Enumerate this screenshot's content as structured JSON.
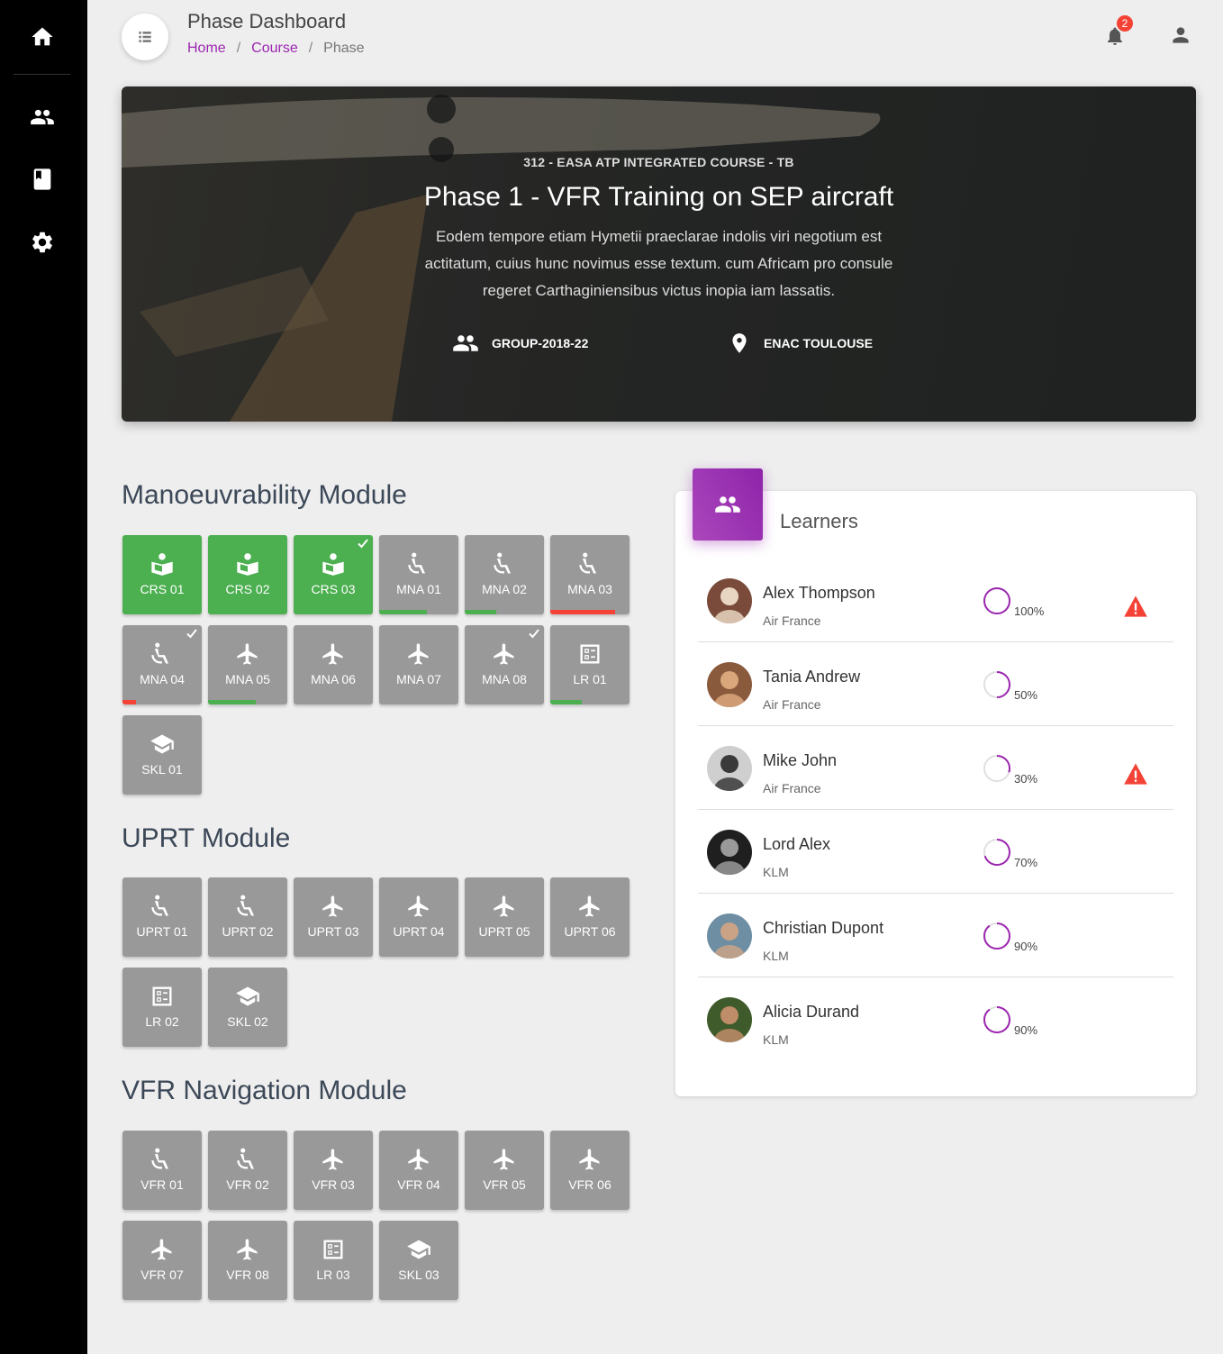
{
  "header": {
    "title": "Phase Dashboard",
    "breadcrumb": [
      "Home",
      "Course",
      "Phase"
    ],
    "notification_count": "2"
  },
  "sidebar": {
    "items": [
      {
        "icon": "home-icon"
      },
      {
        "icon": "people-icon"
      },
      {
        "icon": "book-icon"
      },
      {
        "icon": "gear-icon"
      }
    ]
  },
  "hero": {
    "subtitle": "312 - EASA ATP INTEGRATED COURSE - TB",
    "title": "Phase 1 - VFR Training on SEP aircraft",
    "description": "Eodem tempore etiam Hymetii praeclarae indolis viri negotium est actitatum, cuius hunc novimus esse textum. cum Africam pro consule regeret Carthaginiensibus victus inopia iam lassatis.",
    "group": "GROUP-2018-22",
    "location": "ENAC TOULOUSE"
  },
  "colors": {
    "accent": "#9c27b0",
    "tile_done": "#4caf50",
    "tile_default": "#999999",
    "progress_good": "#4caf50",
    "progress_bad": "#f44336"
  },
  "modules": [
    {
      "title": "Manoeuvrability Module",
      "tiles": [
        {
          "label": "CRS 01",
          "icon": "book-reader-icon",
          "status": "done",
          "checked": false,
          "progress": 0,
          "progress_color": ""
        },
        {
          "label": "CRS 02",
          "icon": "book-reader-icon",
          "status": "done",
          "checked": false,
          "progress": 0,
          "progress_color": ""
        },
        {
          "label": "CRS 03",
          "icon": "book-reader-icon",
          "status": "done",
          "checked": true,
          "progress": 0,
          "progress_color": ""
        },
        {
          "label": "MNA 01",
          "icon": "seat-icon",
          "status": "pending",
          "checked": false,
          "progress": 0.6,
          "progress_color": "#4caf50"
        },
        {
          "label": "MNA 02",
          "icon": "seat-icon",
          "status": "pending",
          "checked": false,
          "progress": 0.4,
          "progress_color": "#4caf50"
        },
        {
          "label": "MNA 03",
          "icon": "seat-icon",
          "status": "pending",
          "checked": false,
          "progress": 0.82,
          "progress_color": "#f44336"
        },
        {
          "label": "MNA 04",
          "icon": "seat-icon",
          "status": "pending",
          "checked": true,
          "progress": 0.17,
          "progress_color": "#f44336"
        },
        {
          "label": "MNA 05",
          "icon": "plane-icon",
          "status": "pending",
          "checked": false,
          "progress": 0.6,
          "progress_color": "#4caf50"
        },
        {
          "label": "MNA 06",
          "icon": "plane-icon",
          "status": "pending",
          "checked": false,
          "progress": 0,
          "progress_color": ""
        },
        {
          "label": "MNA 07",
          "icon": "plane-icon",
          "status": "pending",
          "checked": false,
          "progress": 0,
          "progress_color": ""
        },
        {
          "label": "MNA 08",
          "icon": "plane-icon",
          "status": "pending",
          "checked": true,
          "progress": 0,
          "progress_color": ""
        },
        {
          "label": "LR 01",
          "icon": "checklist-icon",
          "status": "pending",
          "checked": false,
          "progress": 0.4,
          "progress_color": "#4caf50"
        },
        {
          "label": "SKL 01",
          "icon": "graduation-cap-icon",
          "status": "pending",
          "checked": false,
          "progress": 0,
          "progress_color": ""
        }
      ]
    },
    {
      "title": "UPRT Module",
      "tiles": [
        {
          "label": "UPRT 01",
          "icon": "seat-icon",
          "status": "pending",
          "checked": false,
          "progress": 0,
          "progress_color": ""
        },
        {
          "label": "UPRT 02",
          "icon": "seat-icon",
          "status": "pending",
          "checked": false,
          "progress": 0,
          "progress_color": ""
        },
        {
          "label": "UPRT 03",
          "icon": "plane-icon",
          "status": "pending",
          "checked": false,
          "progress": 0,
          "progress_color": ""
        },
        {
          "label": "UPRT 04",
          "icon": "plane-icon",
          "status": "pending",
          "checked": false,
          "progress": 0,
          "progress_color": ""
        },
        {
          "label": "UPRT 05",
          "icon": "plane-icon",
          "status": "pending",
          "checked": false,
          "progress": 0,
          "progress_color": ""
        },
        {
          "label": "UPRT 06",
          "icon": "plane-icon",
          "status": "pending",
          "checked": false,
          "progress": 0,
          "progress_color": ""
        },
        {
          "label": "LR 02",
          "icon": "checklist-icon",
          "status": "pending",
          "checked": false,
          "progress": 0,
          "progress_color": ""
        },
        {
          "label": "SKL 02",
          "icon": "graduation-cap-icon",
          "status": "pending",
          "checked": false,
          "progress": 0,
          "progress_color": ""
        }
      ]
    },
    {
      "title": "VFR Navigation Module",
      "tiles": [
        {
          "label": "VFR 01",
          "icon": "seat-icon",
          "status": "pending",
          "checked": false,
          "progress": 0,
          "progress_color": ""
        },
        {
          "label": "VFR 02",
          "icon": "seat-icon",
          "status": "pending",
          "checked": false,
          "progress": 0,
          "progress_color": ""
        },
        {
          "label": "VFR 03",
          "icon": "plane-icon",
          "status": "pending",
          "checked": false,
          "progress": 0,
          "progress_color": ""
        },
        {
          "label": "VFR 04",
          "icon": "plane-icon",
          "status": "pending",
          "checked": false,
          "progress": 0,
          "progress_color": ""
        },
        {
          "label": "VFR 05",
          "icon": "plane-icon",
          "status": "pending",
          "checked": false,
          "progress": 0,
          "progress_color": ""
        },
        {
          "label": "VFR 06",
          "icon": "plane-icon",
          "status": "pending",
          "checked": false,
          "progress": 0,
          "progress_color": ""
        },
        {
          "label": "VFR 07",
          "icon": "plane-icon",
          "status": "pending",
          "checked": false,
          "progress": 0,
          "progress_color": ""
        },
        {
          "label": "VFR 08",
          "icon": "plane-icon",
          "status": "pending",
          "checked": false,
          "progress": 0,
          "progress_color": ""
        },
        {
          "label": "LR 03",
          "icon": "checklist-icon",
          "status": "pending",
          "checked": false,
          "progress": 0,
          "progress_color": ""
        },
        {
          "label": "SKL 03",
          "icon": "graduation-cap-icon",
          "status": "pending",
          "checked": false,
          "progress": 0,
          "progress_color": ""
        }
      ]
    }
  ],
  "learners": {
    "title": "Learners",
    "items": [
      {
        "name": "Alex Thompson",
        "company": "Air France",
        "progress_label": "100%",
        "progress": 1.0,
        "warning": true,
        "avatar_bg": "#7a4b3a",
        "avatar_fg": "#e8d6c2"
      },
      {
        "name": "Tania Andrew",
        "company": "Air France",
        "progress_label": "50%",
        "progress": 0.5,
        "warning": false,
        "avatar_bg": "#8a5a3d",
        "avatar_fg": "#d9a77b"
      },
      {
        "name": "Mike John",
        "company": "Air France",
        "progress_label": "30%",
        "progress": 0.3,
        "warning": true,
        "avatar_bg": "#cfcfcf",
        "avatar_fg": "#3a3a3a"
      },
      {
        "name": "Lord Alex",
        "company": "KLM",
        "progress_label": "70%",
        "progress": 0.7,
        "warning": false,
        "avatar_bg": "#1f1f1f",
        "avatar_fg": "#9a9a9a"
      },
      {
        "name": "Christian Dupont",
        "company": "KLM",
        "progress_label": "90%",
        "progress": 0.9,
        "warning": false,
        "avatar_bg": "#6d8ea3",
        "avatar_fg": "#caa387"
      },
      {
        "name": "Alicia Durand",
        "company": "KLM",
        "progress_label": "90%",
        "progress": 0.9,
        "warning": false,
        "avatar_bg": "#3f5a2b",
        "avatar_fg": "#c08d6a"
      }
    ]
  }
}
